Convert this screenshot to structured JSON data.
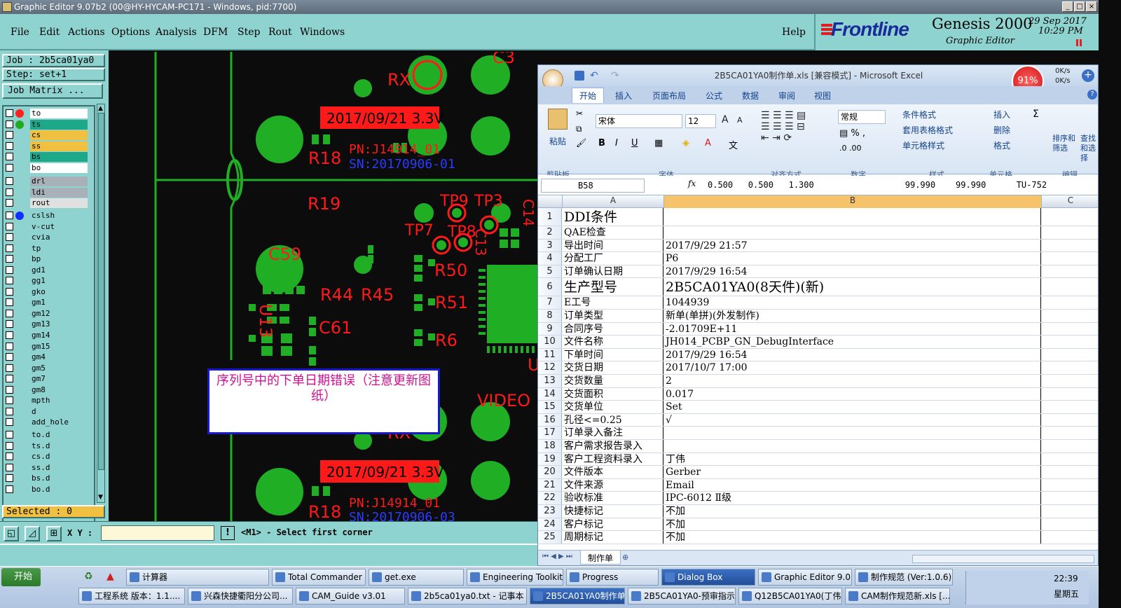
{
  "genesis": {
    "title": "Graphic Editor 9.07b2 (00@HY-HYCAM-PC171 - Windows, pid:7700)",
    "menu": [
      "File",
      "Edit",
      "Actions",
      "Options",
      "Analysis",
      "DFM",
      "Step",
      "Rout",
      "Windows"
    ],
    "help": "Help",
    "brand": "Frontline",
    "product": "Genesis 2000",
    "subtitle": "Graphic Editor",
    "date": "29 Sep 2017",
    "time": "10:29 PM",
    "job_label": "Job : 2b5ca01ya0",
    "step_label": "Step: set+1",
    "job_matrix": "Job Matrix ...",
    "layers": [
      {
        "name": "to",
        "color": "#ffffff",
        "dot": "#ff2020"
      },
      {
        "name": "ts",
        "color": "#1ea88a",
        "dot": "#22aa22"
      },
      {
        "name": "cs",
        "color": "#f0c040",
        "dot": ""
      },
      {
        "name": "ss",
        "color": "#f0c040",
        "dot": ""
      },
      {
        "name": "bs",
        "color": "#1ea88a",
        "dot": ""
      },
      {
        "name": "bo",
        "color": "#ffffff",
        "dot": ""
      },
      {
        "name": "drl",
        "color": "#a8b0b8",
        "dot": ""
      },
      {
        "name": "ldi",
        "color": "#a8b0b8",
        "dot": ""
      },
      {
        "name": "rout",
        "color": "#e0e0e0",
        "dot": ""
      },
      {
        "name": "cslsh",
        "color": "#8fd3d0",
        "dot": "#1030ff"
      },
      {
        "name": "v-cut",
        "color": "#8fd3d0",
        "dot": ""
      },
      {
        "name": "cvia",
        "color": "#8fd3d0",
        "dot": ""
      },
      {
        "name": "tp",
        "color": "#8fd3d0",
        "dot": ""
      },
      {
        "name": "bp",
        "color": "#8fd3d0",
        "dot": ""
      },
      {
        "name": "gd1",
        "color": "#8fd3d0",
        "dot": ""
      },
      {
        "name": "gg1",
        "color": "#8fd3d0",
        "dot": ""
      },
      {
        "name": "gko",
        "color": "#8fd3d0",
        "dot": ""
      },
      {
        "name": "gm1",
        "color": "#8fd3d0",
        "dot": ""
      },
      {
        "name": "gm12",
        "color": "#8fd3d0",
        "dot": ""
      },
      {
        "name": "gm13",
        "color": "#8fd3d0",
        "dot": ""
      },
      {
        "name": "gm14",
        "color": "#8fd3d0",
        "dot": ""
      },
      {
        "name": "gm15",
        "color": "#8fd3d0",
        "dot": ""
      },
      {
        "name": "gm4",
        "color": "#8fd3d0",
        "dot": ""
      },
      {
        "name": "gm5",
        "color": "#8fd3d0",
        "dot": ""
      },
      {
        "name": "gm7",
        "color": "#8fd3d0",
        "dot": ""
      },
      {
        "name": "gm8",
        "color": "#8fd3d0",
        "dot": ""
      },
      {
        "name": "mpth",
        "color": "#8fd3d0",
        "dot": ""
      },
      {
        "name": "d",
        "color": "#8fd3d0",
        "dot": ""
      },
      {
        "name": "add_hole",
        "color": "#8fd3d0",
        "dot": ""
      },
      {
        "name": "to.d",
        "color": "#8fd3d0",
        "dot": ""
      },
      {
        "name": "ts.d",
        "color": "#8fd3d0",
        "dot": ""
      },
      {
        "name": "cs.d",
        "color": "#8fd3d0",
        "dot": ""
      },
      {
        "name": "ss.d",
        "color": "#8fd3d0",
        "dot": ""
      },
      {
        "name": "bs.d",
        "color": "#8fd3d0",
        "dot": ""
      },
      {
        "name": "bo.d",
        "color": "#8fd3d0",
        "dot": ""
      }
    ],
    "selected": "Selected : 0",
    "xy_label": "X Y :",
    "xy_value": "",
    "prompt": "<M1> - Select first corner",
    "canvas_labels": {
      "rx": "RX",
      "date1": "2017/09/21  3.3V",
      "date2": "2017/09/21  3.3V",
      "r18": "R18",
      "r18b": "R18",
      "pn1": "PN:J14914_01",
      "sn1": "SN:20170906-01",
      "pn2": "PN:J14914_01",
      "sn2": "SN:20170906-03",
      "r19": "R19",
      "c59": "C59",
      "tp9": "TP9",
      "tp3": "TP3",
      "c14": "C14",
      "tp7": "TP7",
      "tp8": "TP8",
      "c13": "C13",
      "r50": "R50",
      "r44": "R44",
      "r45": "R45",
      "r51": "R51",
      "u13": "U13",
      "c61": "C61",
      "r6": "R6",
      "video": "VIDEO",
      "rx2": "RX",
      "u": "U",
      "c3": "C3",
      "note": "序列号中的下单日期错误（注意更新图纸）"
    }
  },
  "excel": {
    "title": "2B5CA01YA0制作单.xls [兼容模式] - Microsoft Excel",
    "cpu": "91%",
    "net_up": "0K/s",
    "net_down": "0K/s",
    "tabs": [
      "开始",
      "插入",
      "页面布局",
      "公式",
      "数据",
      "审阅",
      "视图"
    ],
    "groups": [
      "剪贴板",
      "字体",
      "对齐方式",
      "数字",
      "样式",
      "单元格",
      "编辑"
    ],
    "paste": "粘贴",
    "font_name": "宋体",
    "font_size": "12",
    "number_format": "常规",
    "styles": [
      "条件格式",
      "套用表格格式",
      "单元格样式"
    ],
    "cells_btns": [
      "插入",
      "删除",
      "格式"
    ],
    "edit_btns": [
      "排序和筛选",
      "查找和选择"
    ],
    "name_box": "B58",
    "formula": "0.500   0.500   1.300                  99.990    99.990      TU-752",
    "columns": [
      "A",
      "B",
      "C"
    ],
    "rows": [
      {
        "n": "1",
        "a": "DDI条件",
        "b": "",
        "big": true
      },
      {
        "n": "2",
        "a": "QAE检查",
        "b": ""
      },
      {
        "n": "3",
        "a": "导出时间",
        "b": "2017/9/29 21:57"
      },
      {
        "n": "4",
        "a": "分配工厂",
        "b": "P6"
      },
      {
        "n": "5",
        "a": "订单确认日期",
        "b": "2017/9/29 16:54"
      },
      {
        "n": "6",
        "a": "生产型号",
        "b": "2B5CA01YA0(8天件)(新)",
        "big": true
      },
      {
        "n": "7",
        "a": "E工号",
        "b": "1044939"
      },
      {
        "n": "8",
        "a": "订单类型",
        "b": "新单(单拼)(外发制作)"
      },
      {
        "n": "9",
        "a": "合同序号",
        "b": "-2.01709E+11"
      },
      {
        "n": "10",
        "a": "文件名称",
        "b": "JH014_PCBP_GN_DebugInterface"
      },
      {
        "n": "11",
        "a": "下单时间",
        "b": "2017/9/29 16:54"
      },
      {
        "n": "12",
        "a": "交货日期",
        "b": "2017/10/7 17:00"
      },
      {
        "n": "13",
        "a": "交货数量",
        "b": "2"
      },
      {
        "n": "14",
        "a": "交货面积",
        "b": "0.017"
      },
      {
        "n": "15",
        "a": "交货单位",
        "b": "Set"
      },
      {
        "n": "16",
        "a": "孔径<=0.25",
        "b": "√"
      },
      {
        "n": "17",
        "a": "订单录入备注",
        "b": ""
      },
      {
        "n": "18",
        "a": "客户需求报告录入",
        "b": ""
      },
      {
        "n": "19",
        "a": "客户工程资料录入",
        "b": "丁伟"
      },
      {
        "n": "20",
        "a": "文件版本",
        "b": "Gerber"
      },
      {
        "n": "21",
        "a": "文件来源",
        "b": "Email"
      },
      {
        "n": "22",
        "a": "验收标准",
        "b": "IPC-6012 Ⅱ级"
      },
      {
        "n": "23",
        "a": "快捷标记",
        "b": "不加"
      },
      {
        "n": "24",
        "a": "客户标记",
        "b": "不加"
      },
      {
        "n": "25",
        "a": "周期标记",
        "b": "不加"
      }
    ],
    "sheet_tab": "制作单"
  },
  "taskbar": {
    "start": "开始",
    "row1": [
      "计算器",
      "Total Commander 7....",
      "get.exe",
      "Engineering Toolkit 9...",
      "Progress",
      "Dialog Box",
      "Graphic Editor 9.07b...",
      "制作规范 (Ver:1.0.6)"
    ],
    "row2": [
      "工程系统  版本：1.1....",
      "兴森快捷衢阳分公司...",
      "CAM_Guide v3.01",
      "2b5ca01ya0.txt - 记事本",
      "2B5CA01YA0制作单.x...",
      "2B5CA01YA0-预审指示...",
      "Q12B5CA01YA0(丁伟)2...",
      "CAM制作规范新.xls [..."
    ],
    "clock": "22:39",
    "weekday": "星期五"
  },
  "colors": {
    "genesis_panel": "#8fd3d0",
    "pad_green": "#1fae24",
    "silk_red": "#ff1a1a",
    "sn_blue": "#2a3cff",
    "note_magenta": "#d01090",
    "excel_blue": "#15428b"
  }
}
